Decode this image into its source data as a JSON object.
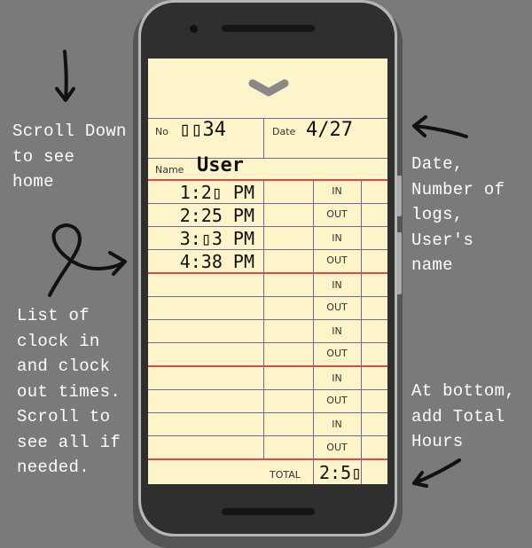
{
  "annotations": {
    "scroll_down": [
      "Scroll Down",
      "to see",
      "home"
    ],
    "list": [
      "List of",
      "clock in",
      "and clock",
      "out times.",
      "Scroll to",
      "see all if",
      "needed."
    ],
    "header_info": [
      "Date,",
      "Number of",
      "logs,",
      "User's",
      "name"
    ],
    "total_info": [
      "At bottom,",
      "add Total",
      "Hours"
    ]
  },
  "card": {
    "no_label": "No",
    "no_value": "▯▯34",
    "date_label": "Date",
    "date_value": "4/27",
    "name_label": "Name",
    "name_value": "User",
    "times": [
      "1:2▯ PM",
      "2:25 PM",
      "3:▯3 PM",
      "4:38 PM"
    ],
    "in_label": "IN",
    "out_label": "OUT",
    "total_label": "TOTAL",
    "total_value": "2:5▯"
  },
  "icons": [
    "chevron-down-icon",
    "arrow-icon"
  ],
  "colors": {
    "background": "#7b7979",
    "card": "#fdf5c9",
    "red_rule": "#e04848",
    "grid": "#6b6b9c"
  }
}
